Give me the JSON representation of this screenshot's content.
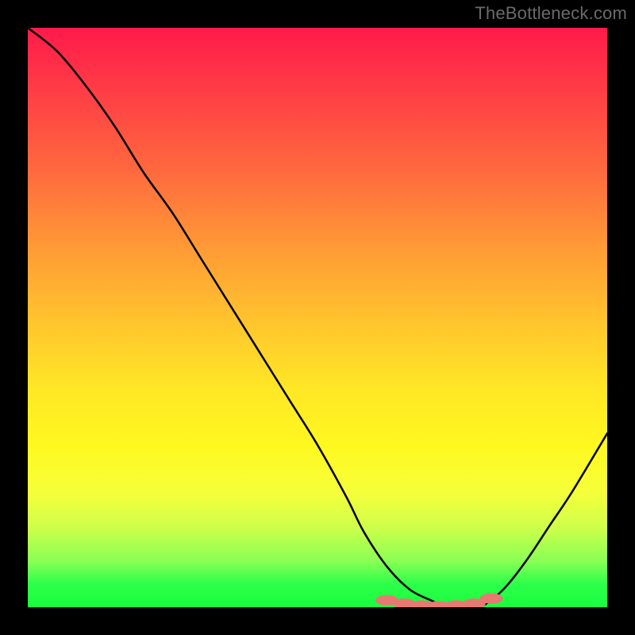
{
  "watermark": "TheBottleneck.com",
  "chart_data": {
    "type": "line",
    "title": "",
    "xlabel": "",
    "ylabel": "",
    "xlim": [
      0,
      100
    ],
    "ylim": [
      0,
      100
    ],
    "series": [
      {
        "name": "curve",
        "x": [
          0,
          5,
          10,
          15,
          20,
          25,
          30,
          35,
          40,
          45,
          50,
          55,
          58,
          62,
          66,
          70,
          72,
          75,
          78,
          82,
          86,
          90,
          94,
          100
        ],
        "y": [
          100,
          96,
          90,
          83,
          75,
          68,
          60,
          52,
          44,
          36,
          28,
          19,
          13,
          7,
          3,
          1,
          0,
          0,
          0,
          3,
          8,
          14,
          20,
          30
        ]
      }
    ],
    "markers": {
      "name": "minimum-band",
      "x": [
        62,
        65,
        68,
        71,
        74,
        77,
        80
      ],
      "y": [
        1.2,
        0.6,
        0.3,
        0.2,
        0.3,
        0.6,
        1.5
      ]
    },
    "background_gradient": {
      "top": "#ff1a4a",
      "mid": "#ffe626",
      "bottom": "#18ff3e"
    }
  }
}
